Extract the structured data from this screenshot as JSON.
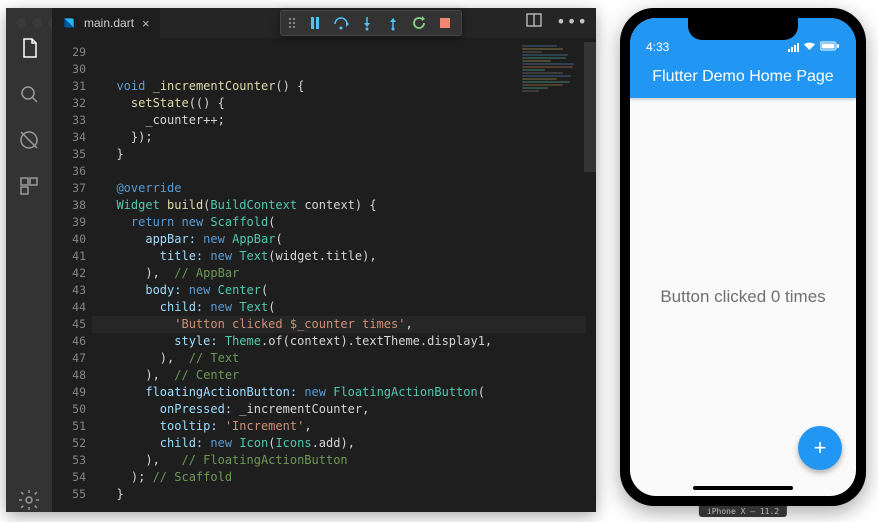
{
  "editor": {
    "tab_label": "main.dart",
    "line_numbers": [
      "29",
      "30",
      "31",
      "32",
      "33",
      "34",
      "35",
      "36",
      "37",
      "38",
      "39",
      "40",
      "41",
      "42",
      "43",
      "44",
      "45",
      "46",
      "47",
      "48",
      "49",
      "50",
      "51",
      "52",
      "53",
      "54",
      "55"
    ]
  },
  "code": {
    "l30_kw": "void",
    "l30_fn": "_incrementCounter",
    "l30_r": "() {",
    "l31_fn": "setState",
    "l31_r": "(() {",
    "l32": "_counter++;",
    "l33": "});",
    "l34": "}",
    "l36": "@override",
    "l37_t": "Widget",
    "l37_fn": "build",
    "l37_mid": "(",
    "l37_t2": "BuildContext",
    "l37_r": " context) {",
    "l38_kw": "return",
    "l38_new": "new",
    "l38_t": "Scaffold",
    "l38_r": "(",
    "l39_p": "appBar:",
    "l39_new": "new",
    "l39_t": "AppBar",
    "l39_r": "(",
    "l40_p": "title:",
    "l40_new": "new",
    "l40_t": "Text",
    "l40_mid": "(widget.title),",
    "l41_a": "),",
    "l41_c": "  // AppBar",
    "l42_p": "body:",
    "l42_new": "new",
    "l42_t": "Center",
    "l42_r": "(",
    "l43_p": "child:",
    "l43_new": "new",
    "l43_t": "Text",
    "l43_r": "(",
    "l44_s": "'Button clicked $_counter times'",
    "l44_r": ",",
    "l45_p": "style:",
    "l45_t": "Theme",
    "l45_mid": ".of(context).textTheme.display1,",
    "l46_a": "),",
    "l46_c": "  // Text",
    "l47_a": "),",
    "l47_c": "  // Center",
    "l48_p": "floatingActionButton:",
    "l48_new": "new",
    "l48_t": "FloatingActionButton",
    "l48_r": "(",
    "l49_p": "onPressed:",
    "l49_r": " _incrementCounter,",
    "l50_p": "tooltip:",
    "l50_s": "'Increment'",
    "l50_r": ",",
    "l51_p": "child:",
    "l51_new": "new",
    "l51_t": "Icon",
    "l51_mid": "(",
    "l51_t2": "Icons",
    "l51_r": ".add),",
    "l52_a": "),",
    "l52_c": "   // FloatingActionButton",
    "l53_a": ");",
    "l53_c": " // Scaffold",
    "l54": "}"
  },
  "simulator": {
    "time": "4:33",
    "app_title": "Flutter Demo Home Page",
    "body_text": "Button clicked 0 times",
    "fab_label": "+",
    "device_label": "iPhone X – 11.2"
  }
}
